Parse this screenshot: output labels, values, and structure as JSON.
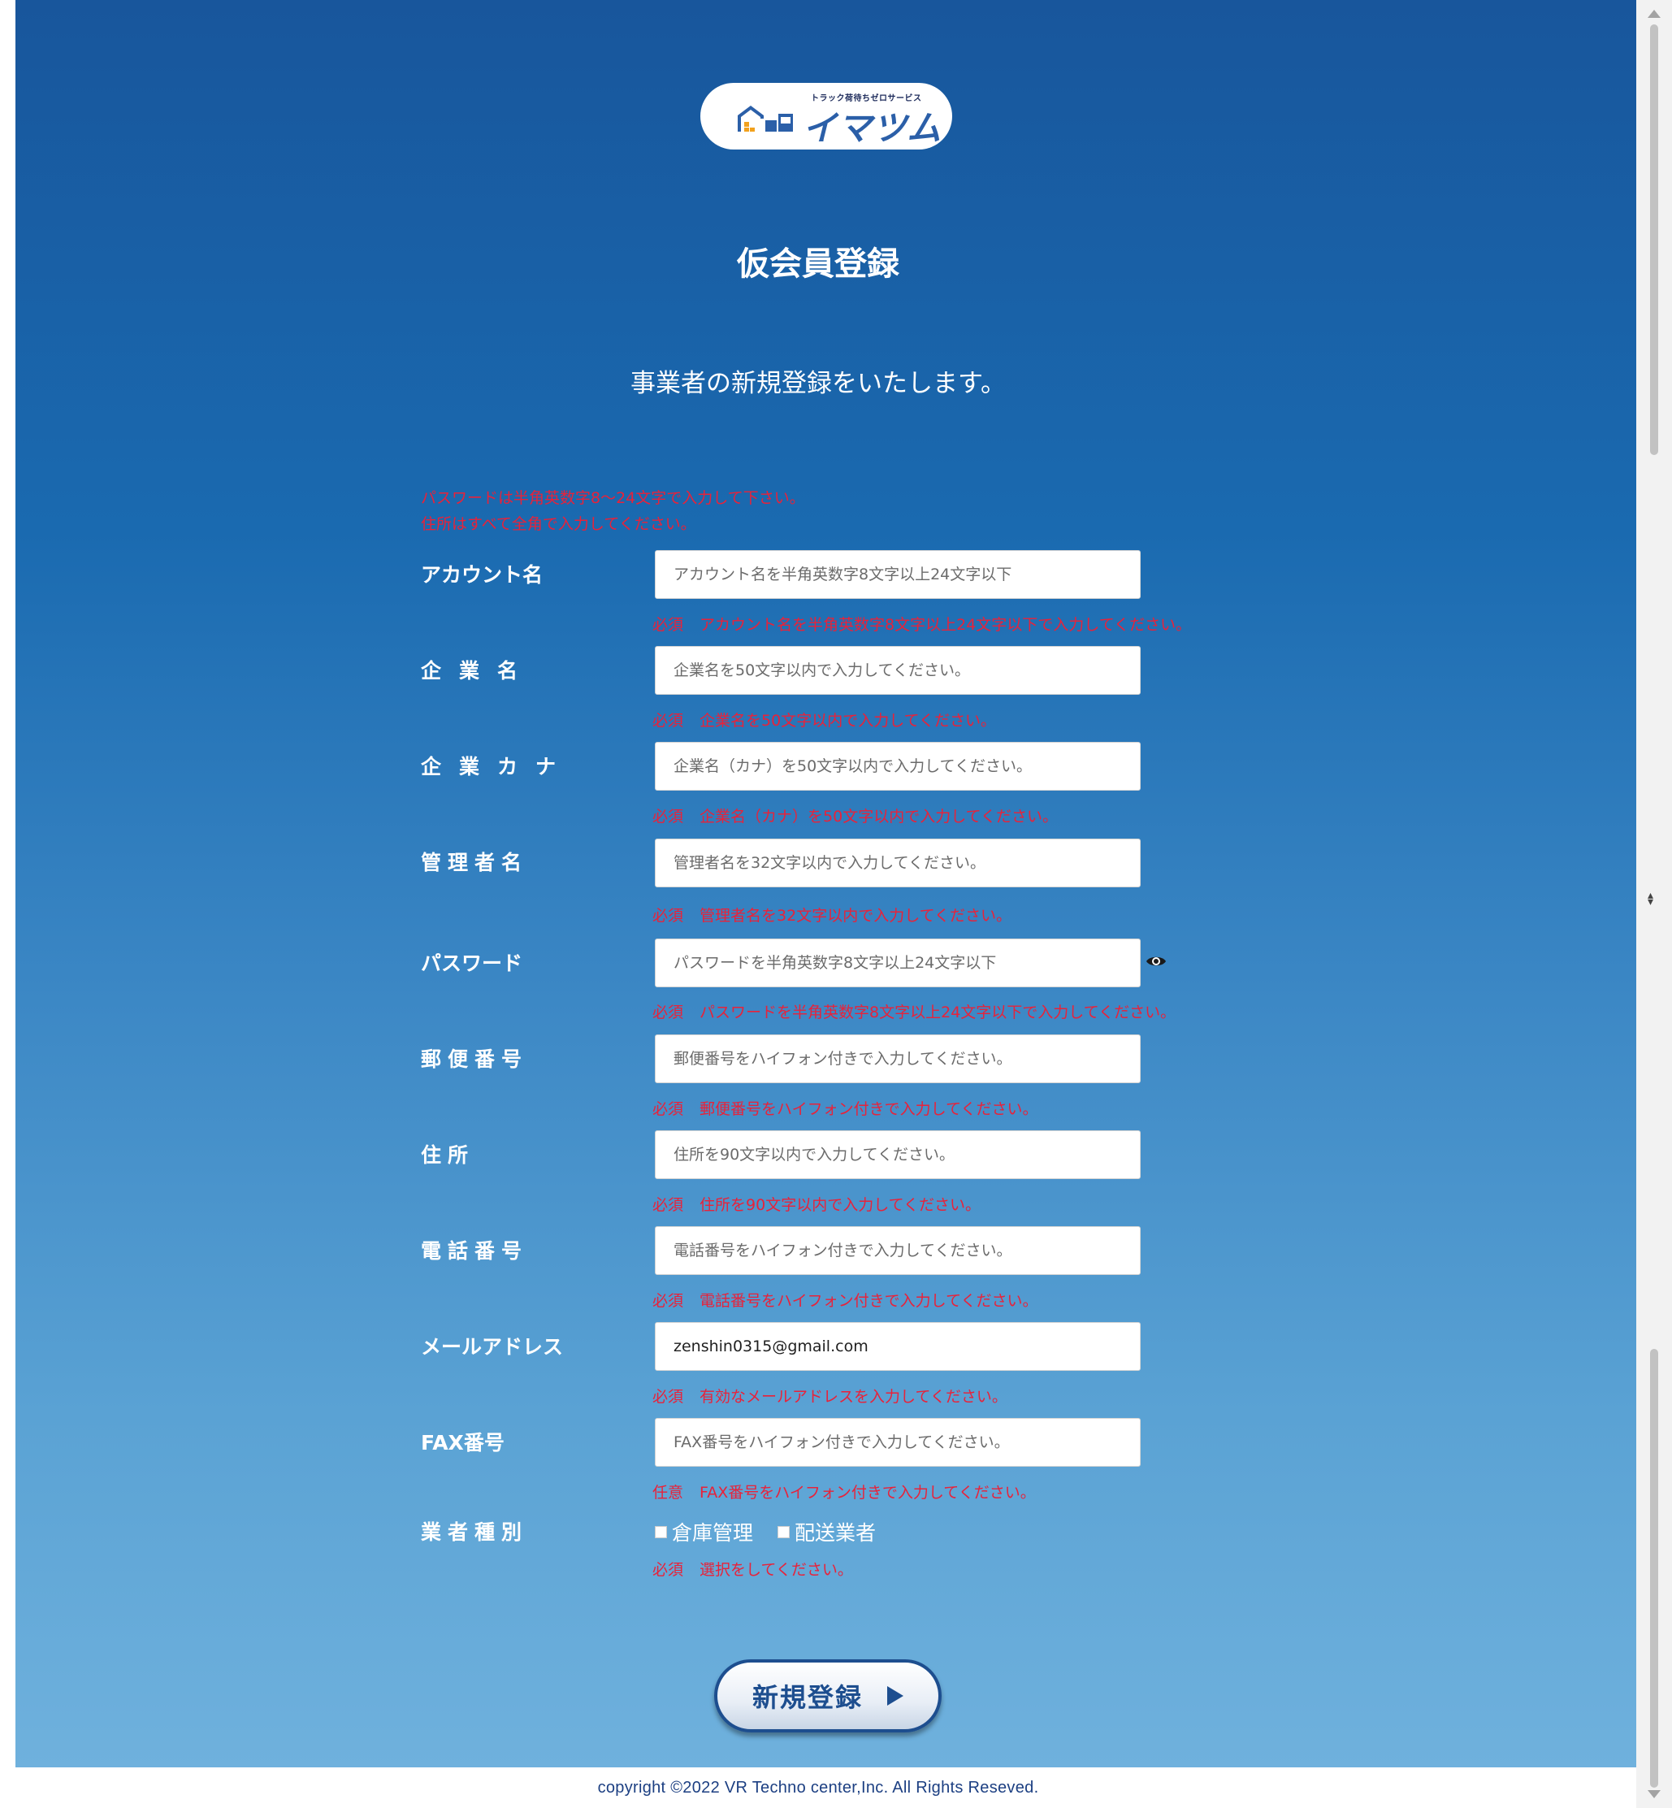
{
  "logo": {
    "tagline": "トラック荷待ちゼロサービス",
    "name": "イマツム"
  },
  "page": {
    "title": "仮会員登録",
    "subtitle": "事業者の新規登録をいたします。",
    "notes": [
      "パスワードは半角英数字8～24文字で入力して下さい。",
      "住所はすべて全角で入力してください。"
    ]
  },
  "form": {
    "fields": [
      {
        "label": "アカウント名",
        "placeholder": "アカウント名を半角英数字8文字以上24文字以下",
        "value": "",
        "req": "必須",
        "hint": "アカウント名を半角英数字8文字以上24文字以下で入力してください。"
      },
      {
        "label": "企業名",
        "placeholder": "企業名を50文字以内で入力してください。",
        "value": "",
        "req": "必須",
        "hint": "企業名を50文字以内で入力してください。"
      },
      {
        "label": "企業カナ",
        "placeholder": "企業名（カナ）を50文字以内で入力してください。",
        "value": "",
        "req": "必須",
        "hint": "企業名（カナ）を50文字以内で入力してください。"
      },
      {
        "label": "管理者名",
        "placeholder": "管理者名を32文字以内で入力してください。",
        "value": "",
        "req": "必須",
        "hint": "管理者名を32文字以内で入力してください。"
      },
      {
        "label": "パスワード",
        "placeholder": "パスワードを半角英数字8文字以上24文字以下",
        "value": "",
        "req": "必須",
        "hint": "パスワードを半角英数字8文字以上24文字以下で入力してください。"
      },
      {
        "label": "郵便番号",
        "placeholder": "郵便番号をハイフォン付きで入力してください。",
        "value": "",
        "req": "必須",
        "hint": "郵便番号をハイフォン付きで入力してください。"
      },
      {
        "label": "住所",
        "placeholder": "住所を90文字以内で入力してください。",
        "value": "",
        "req": "必須",
        "hint": "住所を90文字以内で入力してください。"
      },
      {
        "label": "電話番号",
        "placeholder": "電話番号をハイフォン付きで入力してください。",
        "value": "",
        "req": "必須",
        "hint": "電話番号をハイフォン付きで入力してください。"
      },
      {
        "label": "メールアドレス",
        "placeholder": "",
        "value": "zenshin0315@gmail.com",
        "req": "必須",
        "hint": "有効なメールアドレスを入力してください。"
      },
      {
        "label": "FAX番号",
        "placeholder": "FAX番号をハイフォン付きで入力してください。",
        "value": "",
        "req": "任意",
        "hint": "FAX番号をハイフォン付きで入力してください。"
      }
    ],
    "business_type": {
      "label": "業者種別",
      "options": [
        "倉庫管理",
        "配送業者"
      ],
      "req": "必須",
      "hint": "選択をしてください。"
    },
    "submit_label": "新規登録"
  },
  "footer": {
    "copyright": "copyright ©2022 VR Techno center,Inc. All Rights Reseved."
  },
  "colors": {
    "background_top": "#18569c",
    "background_bottom": "#6fb1dd",
    "error": "#e8223a",
    "button_text": "#1d4e8f"
  },
  "icons": {
    "password_toggle": "eye-icon",
    "submit": "play-arrow-icon",
    "logo": "warehouse-truck-icon"
  }
}
